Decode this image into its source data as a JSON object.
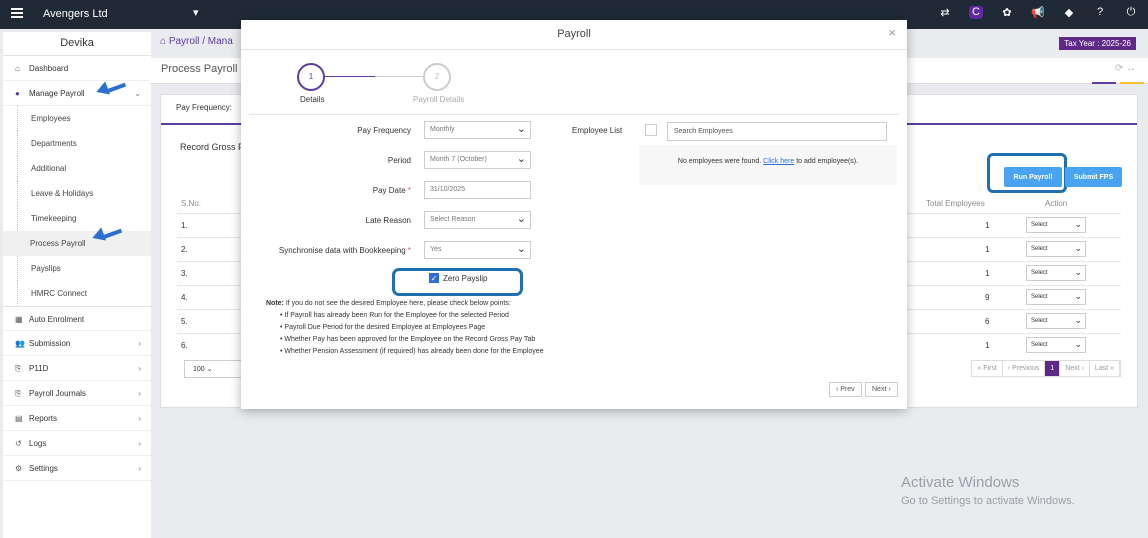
{
  "topbar": {
    "company": "Avengers Ltd",
    "icons": [
      "transfer-icon",
      "brand-icon",
      "cookie-icon",
      "megaphone-icon",
      "ticket-icon",
      "help-icon",
      "power-icon"
    ],
    "icon_glyphs": [
      "⇄",
      "C",
      "✿",
      "📢",
      "◆",
      "?",
      "⏻"
    ]
  },
  "sidebar": {
    "user": "Devika",
    "top_items": [
      {
        "label": "Dashboard",
        "icon": "home-icon",
        "glyph": "⌂"
      },
      {
        "label": "Manage Payroll",
        "icon": "user-icon",
        "glyph": "●"
      }
    ],
    "sub_items": [
      "Employees",
      "Departments",
      "Additional",
      "Leave & Holidays",
      "Timekeeping",
      "Process Payroll",
      "Payslips",
      "HMRC Connect"
    ],
    "bottom_items": [
      {
        "label": "Auto Enrolment",
        "icon": "grid-icon",
        "glyph": "▦"
      },
      {
        "label": "Submission",
        "icon": "users-icon",
        "glyph": "👥"
      },
      {
        "label": "P11D",
        "icon": "copy-icon",
        "glyph": "⎘"
      },
      {
        "label": "Payroll Journals",
        "icon": "copy-icon",
        "glyph": "⎘"
      },
      {
        "label": "Reports",
        "icon": "document-icon",
        "glyph": "▤"
      },
      {
        "label": "Logs",
        "icon": "history-icon",
        "glyph": "↺"
      },
      {
        "label": "Settings",
        "icon": "gear-icon",
        "glyph": "⚙"
      }
    ]
  },
  "header": {
    "crumb_home": "Payroll",
    "crumb_sep": "/",
    "crumb_next": "Mana",
    "tax_year": "Tax Year : 2025-26",
    "page_title": "Process Payroll"
  },
  "card": {
    "tab_label": "Pay Frequency:",
    "record_label": "Record Gross Pa",
    "run_payroll": "Run Payroll",
    "submit_fps": "Submit FPS",
    "col_sno": "S.No.",
    "col_total": "Total Employees",
    "col_action": "Action",
    "rows": [
      {
        "sno": "1.",
        "total": "1",
        "action": "Select"
      },
      {
        "sno": "2.",
        "total": "1",
        "action": "Select"
      },
      {
        "sno": "3.",
        "total": "1",
        "action": "Select"
      },
      {
        "sno": "4.",
        "total": "9",
        "action": "Select"
      },
      {
        "sno": "5.",
        "total": "6",
        "action": "Select"
      },
      {
        "sno": "6.",
        "total": "1",
        "action": "Select"
      }
    ],
    "per_page": "100",
    "pager": [
      "« First",
      "‹ Previous",
      "1",
      "Next ›",
      "Last »"
    ]
  },
  "watermark": {
    "line1": "Activate Windows",
    "line2": "Go to Settings to activate Windows."
  },
  "modal": {
    "title": "Payroll",
    "close": "×",
    "step1_num": "1",
    "step1_label": "Details",
    "step2_num": "2",
    "step2_label": "Payroll Details",
    "fields": {
      "pay_frequency_label": "Pay Frequency",
      "pay_frequency_value": "Monthly",
      "period_label": "Period",
      "period_value": "Month 7 (October)",
      "pay_date_label": "Pay Date",
      "pay_date_value": "31/10/2025",
      "late_reason_label": "Late Reason",
      "late_reason_value": "Select Reason",
      "sync_label": "Synchronise data with Bookkeeping",
      "sync_value": "Yes",
      "zero_payslip": "Zero Payslip",
      "required_mark": "*"
    },
    "employee_list_label": "Employee List",
    "search_placeholder": "Search Employees",
    "no_employees_pre": "No employees were found.",
    "no_employees_link": "Click here",
    "no_employees_post": "to add employee(s).",
    "note_title": "Note:",
    "note_intro": "If you do not see the desired Employee here, please check below points:",
    "note_points": [
      "If Payroll has already been Run for the Employee for the selected Period",
      "Payroll Due Period for the desired Employee at Employees Page",
      "Whether Pay has been approved for the Employee on the Record Gross Pay Tab",
      "Whether Pension Assessment (if required) has already been done for the Employee"
    ],
    "prev": "‹ Prev",
    "next": "Next ›"
  },
  "colors": {
    "topbar": "#1f2a36",
    "accent": "#5e3ca0",
    "tax_badge": "#5e2a86",
    "button": "#4aa3f0",
    "annotation": "#1f6fb2"
  }
}
